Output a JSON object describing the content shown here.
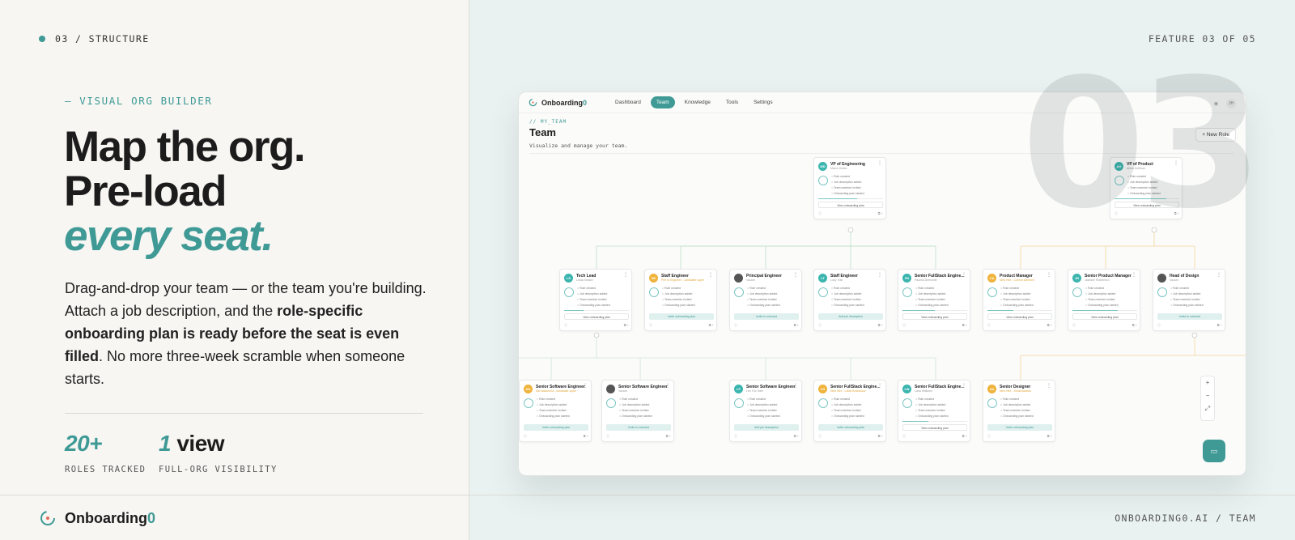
{
  "section_tag": "03 / STRUCTURE",
  "feature_count": "FEATURE 03 OF 05",
  "big_number": "03",
  "eyebrow": "— VISUAL ORG BUILDER",
  "headline": {
    "line1": "Map the org.",
    "line2": "Pre-load",
    "line3": "every seat."
  },
  "description": {
    "part1": "Drag-and-drop your team — or the team you're building. Attach a job description, and the ",
    "bold": "role-specific onboarding plan is ready before the seat is even filled",
    "part2": ". No more three-week scramble when someone starts."
  },
  "stats": [
    {
      "number": "20+",
      "text": "",
      "label": "ROLES TRACKED"
    },
    {
      "number": "1",
      "text": " view",
      "label": "FULL-ORG VISIBILITY"
    }
  ],
  "footer": {
    "brand_name": "Onboarding",
    "brand_suffix": "0",
    "url": "ONBOARDING0.AI / TEAM"
  },
  "app": {
    "logo": "Onboarding",
    "logo_suffix": "0",
    "tabs": [
      "Dashboard",
      "Team",
      "Knowledge",
      "Tools",
      "Settings"
    ],
    "active_tab": "Team",
    "avatar": "JH",
    "breadcrumb": "// MY_TEAM",
    "title": "Team",
    "subtitle": "Visualize and manage your team.",
    "new_role_button": "New Role",
    "cards": [
      {
        "title": "VP of Engineering",
        "sub": "Marco Dolles",
        "initials": "MD",
        "color": "#3bb5ae",
        "action": "View onboarding plan",
        "progress": 0.6
      },
      {
        "title": "VP of Product",
        "sub": "Alexa Hoffman",
        "initials": "AH",
        "color": "#3bb5ae",
        "action": "View onboarding plan",
        "progress": 0.8
      },
      {
        "title": "Tech Lead",
        "sub": "Linda Seaton",
        "initials": "LS",
        "color": "#3bb5ae",
        "action": "View onboarding plan",
        "progress": 0.3
      },
      {
        "title": "Staff Engineer",
        "sub": "Pee to Engineer - candidate super",
        "initials": "SE",
        "color": "#f0b33b",
        "action": "Invite onboarding plan",
        "progress": 0
      },
      {
        "title": "Principal Engineer",
        "sub": "Vacant",
        "initials": "",
        "color": "#555555",
        "action": "Invite to onboard",
        "progress": 0
      },
      {
        "title": "Staff Engineer",
        "sub": "Lucy Tran",
        "initials": "LT",
        "color": "#3bb5ae",
        "action": "Add job description",
        "progress": 0
      },
      {
        "title": "Senior FullStack Engine...",
        "sub": "Paulina Delmonte",
        "initials": "PD",
        "color": "#3bb5ae",
        "action": "View onboarding plan",
        "progress": 0.5
      },
      {
        "title": "Product Manager",
        "sub": "New Hire - Connor Albrecht",
        "initials": "CA",
        "color": "#f0b33b",
        "action": "View onboarding plan",
        "progress": 0.4
      },
      {
        "title": "Senior Product Manager",
        "sub": "Jasmine Rutherford",
        "initials": "JR",
        "color": "#3bb5ae",
        "action": "View onboarding plan",
        "progress": 0.7
      },
      {
        "title": "Head of Design",
        "sub": "Vacant",
        "initials": "",
        "color": "#555555",
        "action": "Invite to onboard",
        "progress": 0
      },
      {
        "title": "Senior Software Engineer",
        "sub": "Kai Nakamura - candidate super",
        "initials": "KN",
        "color": "#f0b33b",
        "action": "Invite onboarding plan",
        "progress": 0
      },
      {
        "title": "Senior Software Engineer",
        "sub": "Vacant",
        "initials": "",
        "color": "#555555",
        "action": "Invite to onboard",
        "progress": 0
      },
      {
        "title": "Senior Software Engineer",
        "sub": "Leo Fox Hale",
        "initials": "LF",
        "color": "#3bb5ae",
        "action": "Add job description",
        "progress": 0
      },
      {
        "title": "Senior FullStack Engine...",
        "sub": "New Hire - Lolita Rosewood",
        "initials": "LR",
        "color": "#f0b33b",
        "action": "Invite onboarding plan",
        "progress": 0
      },
      {
        "title": "Senior FullStack Engine...",
        "sub": "Lana Williams",
        "initials": "LW",
        "color": "#3bb5ae",
        "action": "View onboarding plan",
        "progress": 0.4
      },
      {
        "title": "Senior Designer",
        "sub": "New Hire - Sonia Alcaraz",
        "initials": "SA",
        "color": "#f0b33b",
        "action": "Invite onboarding plan",
        "progress": 0
      }
    ],
    "checklist": [
      "Role created",
      "Job description added",
      "Team member invited",
      "Onboarding plan started"
    ],
    "progress_label": "Onboarding",
    "zoom_in": "+",
    "zoom_out": "−"
  }
}
